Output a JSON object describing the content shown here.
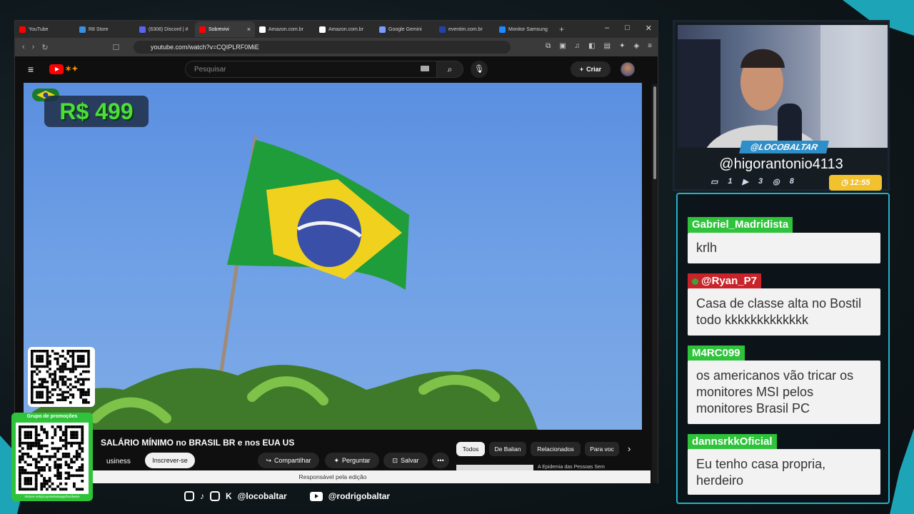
{
  "browser": {
    "tabs": [
      {
        "label": "YouTube",
        "color": "#ff0000"
      },
      {
        "label": "R8 Store",
        "color": "#3a8fe0"
      },
      {
        "label": "(6308) Discord | #",
        "color": "#5865f2"
      },
      {
        "label": "Sobrevivi",
        "color": "#ff0000",
        "active": true
      },
      {
        "label": "Amazon.com.br",
        "color": "#ffffff"
      },
      {
        "label": "Amazon.com.br",
        "color": "#ffffff"
      },
      {
        "label": "Google Gemini",
        "color": "#7a9cff"
      },
      {
        "label": "eventim.com.br",
        "color": "#2244aa"
      },
      {
        "label": "Monitor Samsung",
        "color": "#1a8cff"
      }
    ],
    "new_tab": "+",
    "url": "youtube.com/watch?v=CQIPLRF0MiE"
  },
  "youtube": {
    "search_placeholder": "Pesquisar",
    "create_label": "Criar",
    "video_title": "SALÁRIO MÍNIMO no BRASIL BR e nos EUA US",
    "channel": "usiness",
    "subscribe_label": "Inscrever-se",
    "actions": [
      "Compartilhar",
      "Perguntar",
      "Salvar",
      "•••"
    ],
    "chips": [
      "Todos",
      "De Balian",
      "Relacionados",
      "Para voc"
    ],
    "edit_notice": "Responsável pela edição",
    "related_title": "A Epidemia das Pessoas Sem"
  },
  "overlay": {
    "price": "R$ 499",
    "qr_group_label": "Grupo de promoções",
    "qr_group_url": "r8store.net/groups/whatsapp/hardware",
    "social_handle_1": "@locobaltar",
    "social_handle_2": "@rodrigobaltar"
  },
  "webcam": {
    "badge": "@LOCOBALTAR",
    "handle": "@higorantonio4113",
    "stats": [
      "1",
      "3",
      "8"
    ],
    "timer": "12:55"
  },
  "chat": [
    {
      "user": "Gabriel_Madridista",
      "color": "#2ec33a",
      "text": "krlh"
    },
    {
      "user": "@Ryan_P7",
      "color": "#c8232a",
      "text": "Casa de classe alta no Bostil todo kkkkkkkkkkkkk"
    },
    {
      "user": "M4RC099",
      "color": "#2ec33a",
      "text": "os americanos vão tricar os monitores MSI pelos monitores Brasil PC"
    },
    {
      "user": "dannsrkkOficial",
      "color": "#2ec33a",
      "text": "Eu tenho casa propria, herdeiro"
    }
  ],
  "colors": {
    "accent": "#23b2c8",
    "price_green": "#4cde3a",
    "timer": "#f2c12e"
  }
}
